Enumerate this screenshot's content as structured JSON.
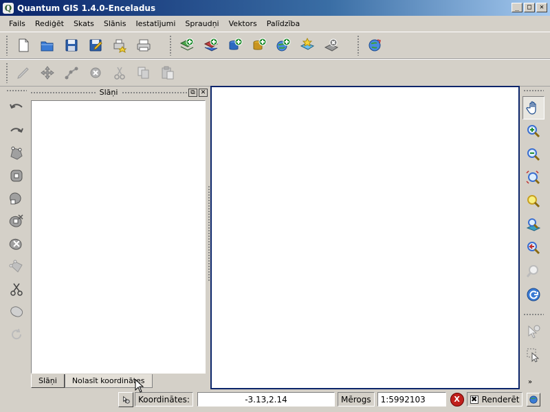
{
  "window": {
    "title": "Quantum GIS 1.4.0-Enceladus",
    "logo_letter": "Q",
    "min_glyph": "_",
    "max_glyph": "□",
    "close_glyph": "✕"
  },
  "menu": [
    "Fails",
    "Rediģēt",
    "Skats",
    "Slānis",
    "Iestatījumi",
    "Spraudņi",
    "Vektors",
    "Palīdzība"
  ],
  "toolbar_file": [
    "new-project-icon",
    "open-project-icon",
    "save-project-icon",
    "save-as-project-icon",
    "print-composer-icon",
    "print-icon"
  ],
  "toolbar_layers": [
    "add-raster-layer-icon",
    "add-vector-layer-icon",
    "add-postgis-layer-icon",
    "add-spatialite-layer-icon",
    "add-wms-layer-icon",
    "new-shapefile-icon",
    "remove-layer-icon"
  ],
  "toolbar_plugins": [
    "georeferencer-globe-icon"
  ],
  "toolbar_edit": [
    "toggle-editing-icon",
    "move-feature-icon",
    "node-tool-icon",
    "delete-selected-icon",
    "cut-features-icon",
    "copy-features-icon",
    "paste-features-icon"
  ],
  "left_tools": [
    "undo-icon",
    "redo-icon",
    "simplify-feature-icon",
    "add-ring-icon",
    "add-island-icon",
    "delete-ring-icon",
    "delete-part-icon",
    "reshape-features-icon",
    "split-features-icon",
    "merge-features-icon",
    "rotate-point-symbols-icon"
  ],
  "layers_panel": {
    "title": "Slāņi",
    "float_glyph": "⧉",
    "close_glyph": "✕",
    "tabs": [
      "Slāņi",
      "Nolasīt koordinātes"
    ]
  },
  "right_tools": [
    "pan-hand-icon",
    "zoom-in-icon",
    "zoom-out-icon",
    "zoom-full-icon",
    "zoom-to-selection-icon",
    "zoom-to-layer-icon",
    "zoom-last-icon",
    "zoom-actual-size-icon",
    "refresh-icon",
    "identify-icon",
    "select-features-icon"
  ],
  "right_more_glyph": "»",
  "status": {
    "coords_label": "Koordinātes:",
    "coords_value": "-3.13,2.14",
    "scale_label": "Mērogs",
    "scale_value": "1:5992103",
    "stop_render_glyph": "X",
    "render_checked_glyph": "✖",
    "render_label": "Renderēt"
  },
  "colors": {
    "title_start": "#0a246a",
    "title_end": "#a6caf0",
    "canvas_border": "#0a246a",
    "stop_button": "#c0201c"
  }
}
